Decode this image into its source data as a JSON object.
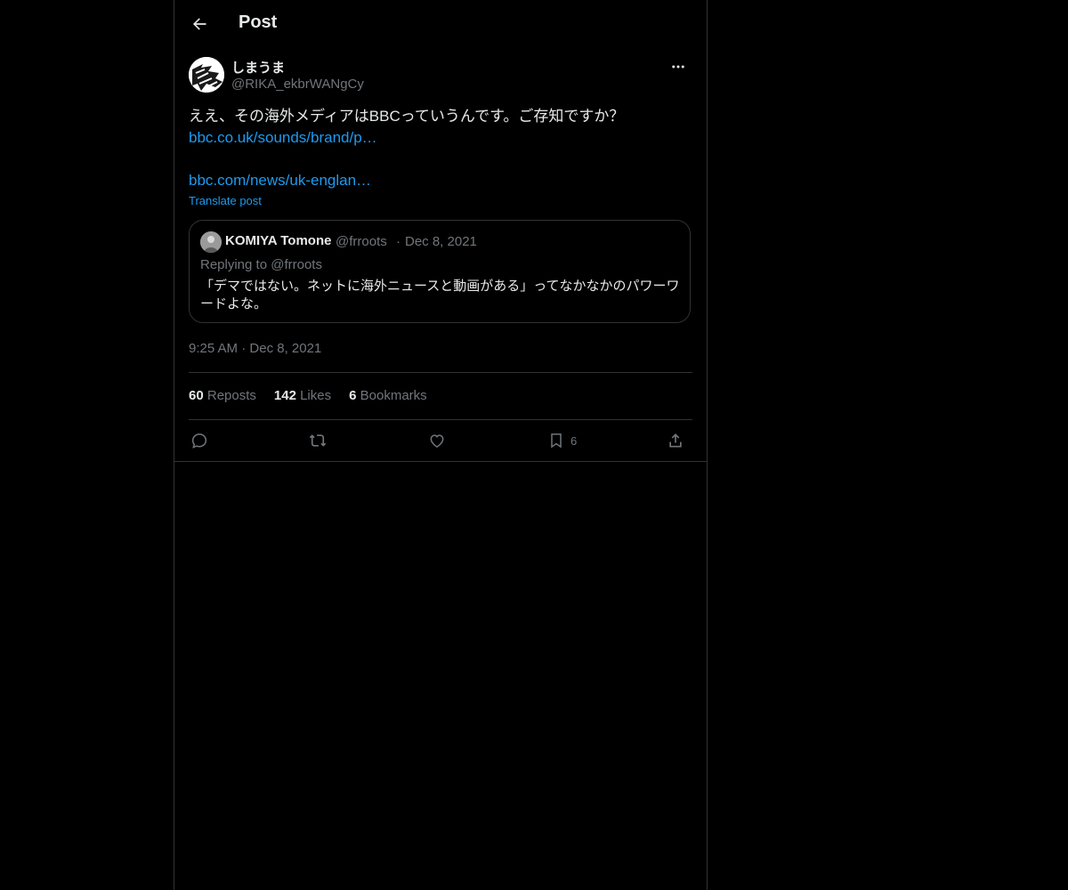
{
  "header": {
    "title": "Post"
  },
  "author": {
    "display_name": "しまうま",
    "handle": "@RIKA_ekbrWANgCy"
  },
  "post": {
    "text": "ええ、その海外メディアはBBCっていうんです。ご存知ですか？",
    "link1": "bbc.co.uk/sounds/brand/p…",
    "link2": "bbc.com/news/uk-englan…",
    "translate_label": "Translate post",
    "time": "9:25 AM",
    "sep": "·",
    "date": "Dec 8, 2021"
  },
  "quote": {
    "name": "KOMIYA Tomone",
    "handle": "@frroots",
    "sep": "·",
    "date": "Dec 8, 2021",
    "replying_prefix": "Replying to",
    "replying_handle": "@frroots",
    "text": "「デマではない。ネットに海外ニュースと動画がある」ってなかなかのパワーワードよな。"
  },
  "stats": {
    "reposts_count": "60",
    "reposts_label": "Reposts",
    "likes_count": "142",
    "likes_label": "Likes",
    "bookmarks_count": "6",
    "bookmarks_label": "Bookmarks"
  },
  "actions": {
    "reply_icon": "reply-icon",
    "repost_icon": "repost-icon",
    "like_icon": "heart-icon",
    "bookmark_icon": "bookmark-icon",
    "bookmark_count": "6",
    "share_icon": "share-icon"
  },
  "colors": {
    "background": "#000000",
    "text": "#e7e9ea",
    "muted": "#71767b",
    "accent": "#1d9bf0",
    "border": "#2f3336"
  }
}
